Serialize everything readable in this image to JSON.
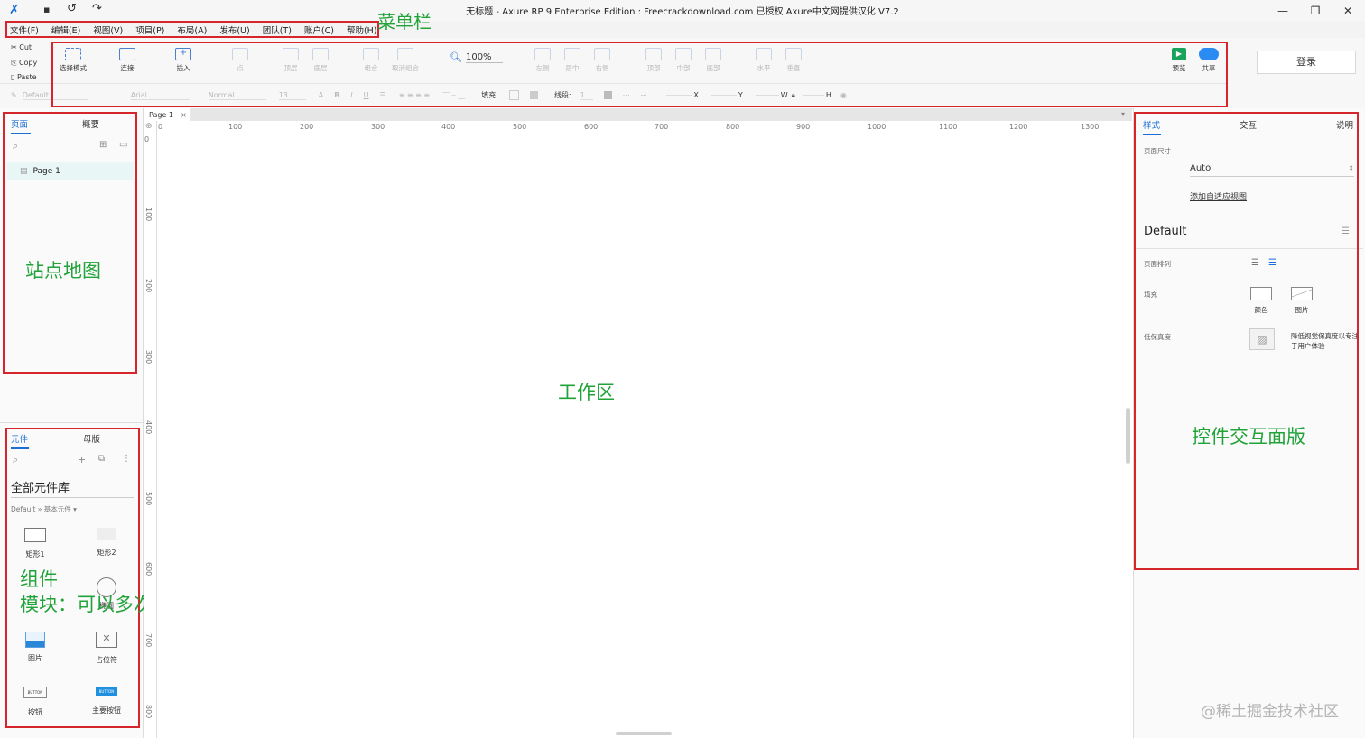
{
  "window": {
    "title": "无标题 - Axure RP 9 Enterprise Edition : Freecrackdownload.com 已授权     Axure中文网提供汉化 V7.2",
    "minimize": "—",
    "maximize": "❐",
    "close": "✕"
  },
  "menubar": {
    "items": [
      "文件(F)",
      "编辑(E)",
      "视图(V)",
      "项目(P)",
      "布局(A)",
      "发布(U)",
      "团队(T)",
      "账户(C)",
      "帮助(H)"
    ],
    "annotation": "菜单栏"
  },
  "clipboard": {
    "cut": "Cut",
    "copy": "Copy",
    "paste": "Paste"
  },
  "toolbar": {
    "select_mode": "选择模式",
    "connect": "连接",
    "insert": "插入",
    "point": "点",
    "top_layer": "顶层",
    "bottom_layer": "底层",
    "group": "组合",
    "ungroup": "取消组合",
    "zoom": "100%",
    "align_left": "左侧",
    "align_center": "居中",
    "align_right": "右侧",
    "align_top": "顶部",
    "align_middle": "中部",
    "align_bottom": "底部",
    "distribute_h": "水平",
    "distribute_v": "垂直",
    "preview": "预览",
    "share": "共享",
    "login": "登录"
  },
  "format_bar": {
    "style": "Default",
    "font": "Arial",
    "weight": "Normal",
    "size": "13",
    "fill_label": "填充:",
    "line_label": "线段:",
    "line_value": "1",
    "x_label": "X",
    "y_label": "Y",
    "w_label": "W",
    "h_label": "H"
  },
  "pages_panel": {
    "tab_pages": "页面",
    "tab_outline": "概要",
    "page_item": "Page 1",
    "annotation": "站点地图"
  },
  "library_panel": {
    "tab_widgets": "元件",
    "tab_masters": "母版",
    "library_select": "全部元件库",
    "breadcrumb": "Default » 基本元件 ▾",
    "widgets": [
      "矩形1",
      "矩形2",
      "椭圆",
      "图片",
      "占位符",
      "按钮",
      "主要按钮"
    ],
    "button_text": "BUTTON",
    "annotation_line1": "组件",
    "annotation_line2": "模块：可以多次应用到各个页面"
  },
  "canvas": {
    "tab": "Page 1",
    "tab_close": "×",
    "ruler_h": [
      "0",
      "100",
      "200",
      "300",
      "400",
      "500",
      "600",
      "700",
      "800",
      "900",
      "1000",
      "1100",
      "1200",
      "1300"
    ],
    "ruler_v": [
      "0",
      "100",
      "200",
      "300",
      "400",
      "500",
      "600",
      "700",
      "800"
    ],
    "annotation": "工作区"
  },
  "inspector": {
    "tab_style": "样式",
    "tab_interaction": "交互",
    "tab_notes": "说明",
    "page_size_label": "页面尺寸",
    "page_size_value": "Auto",
    "adaptive_link": "添加自适应视图",
    "style_name": "Default",
    "page_align_label": "页面排列",
    "fill_label": "填充",
    "fill_color": "颜色",
    "fill_image": "图片",
    "low_fi_label": "低保真度",
    "low_fi_desc": "降低视觉保真度以专注于用户体验",
    "annotation": "控件交互面版"
  },
  "watermark": "@稀土掘金技术社区",
  "colors": {
    "accent": "#1b6ed4",
    "annotation_red": "#d6262b",
    "annotation_green": "#22a33a"
  }
}
